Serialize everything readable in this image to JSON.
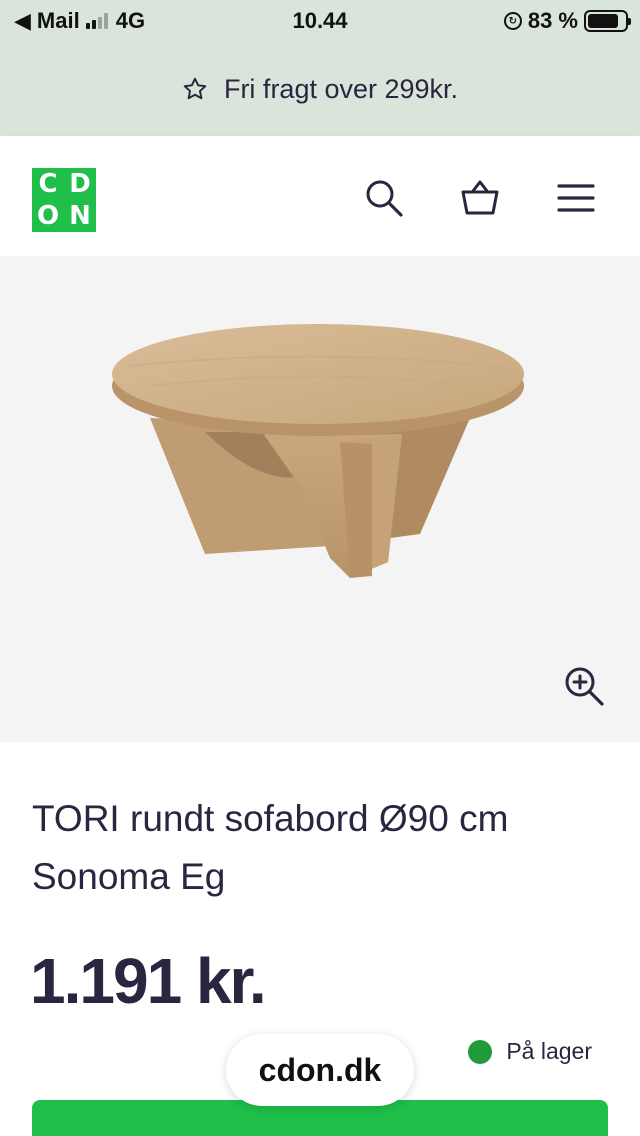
{
  "status_bar": {
    "back_app": "Mail",
    "network": "4G",
    "time": "10.44",
    "battery": "83 %"
  },
  "promo": {
    "text": "Fri fragt over 299kr.",
    "icon": "star-outline-icon"
  },
  "header": {
    "logo_letters": [
      "C",
      "D",
      "O",
      "N"
    ],
    "icons": [
      "search-icon",
      "basket-icon",
      "menu-icon"
    ]
  },
  "product": {
    "title_line1": "TORI rundt sofabord Ø90 cm",
    "title_line2": "Sonoma Eg",
    "price": "1.191 kr.",
    "stock": "På lager"
  },
  "browser": {
    "url": "cdon.dk"
  },
  "colors": {
    "brand_green": "#1fbf4a",
    "stock_green": "#1f9b3b",
    "promo_bg": "#d9e4da",
    "text_dark": "#2a2640"
  }
}
